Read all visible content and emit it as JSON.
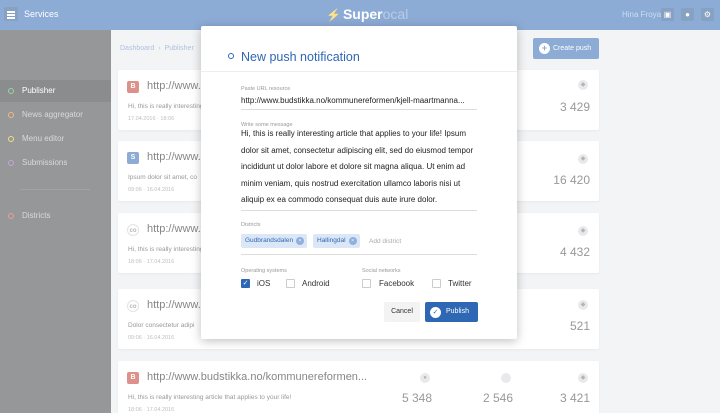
{
  "topbar": {
    "services_label": "Services",
    "logo_main": "Super",
    "logo_faded": "ocal",
    "user_name": "Hina Froya",
    "icons": [
      "menu-icon",
      "panel-icon",
      "user-icon",
      "settings-icon"
    ]
  },
  "sidebar": {
    "items": [
      {
        "label": "Publisher",
        "color": "#4caf50"
      },
      {
        "label": "News aggregator",
        "color": "#e67e22"
      },
      {
        "label": "Menu editor",
        "color": "#f1c40f"
      },
      {
        "label": "Submissions",
        "color": "#9b59b6"
      },
      {
        "label": "Districts",
        "color": "#e74c3c"
      }
    ]
  },
  "breadcrumb": {
    "root": "Dashboard",
    "current": "Publisher"
  },
  "create_button": "Create push",
  "cards": [
    {
      "icon": "B",
      "url": "http://www.b",
      "text": "Hi, this is really interesting",
      "date": "17.04.2016 · 18:06",
      "stats": [
        "3 429"
      ]
    },
    {
      "icon": "S",
      "url": "http://www.s",
      "text": "Ipsum dolor sit amet, co",
      "date": "09:06 · 16.04.2016",
      "stats": [
        "16 420"
      ]
    },
    {
      "icon": "co",
      "url": "http://www.w",
      "text": "Hi, this is really interesting",
      "date": "18:06 · 17.04.2016",
      "stats": [
        "4 432"
      ]
    },
    {
      "icon": "co",
      "url": "http://www.s",
      "text": "Dolor consectetur adipi",
      "date": "09:06 · 16.04.2016",
      "stats": [
        "521"
      ]
    },
    {
      "icon": "B",
      "url": "http://www.budstikka.no/kommunereformen...",
      "text": "Hi, this is really interesting article that applies to your life!",
      "date": "18:06 · 17.04.2016",
      "stats": [
        "5 348",
        "2 546",
        "3 421"
      ]
    }
  ],
  "modal": {
    "title": "New push notification",
    "url_label": "Paste URL resource",
    "url_value": "http://www.budstikka.no/kommunereformen/kjell-maartmanna...",
    "message_label": "Write some message",
    "message": "Hi, this is really interesting article that applies to your life! Ipsum dolor sit amet, consectetur adipiscing elit, sed do eiusmod tempor incididunt ut dolor labore et dolore sit magna aliqua. Ut enim ad minim veniam, quis nostrud exercitation ullamco laboris nisi ut aliquip ex ea commodo consequat duis aute irure dolor.",
    "districts_label": "Districts",
    "districts": [
      "Gudbrandsdalen",
      "Hallingdal"
    ],
    "add_district_placeholder": "Add district",
    "os_label": "Operating systems",
    "os": [
      {
        "label": "iOS",
        "checked": true
      },
      {
        "label": "Android",
        "checked": false
      }
    ],
    "social_label": "Social networks",
    "social": [
      {
        "label": "Facebook",
        "checked": false
      },
      {
        "label": "Twitter",
        "checked": false
      }
    ],
    "cancel_label": "Cancel",
    "publish_label": "Publish"
  }
}
